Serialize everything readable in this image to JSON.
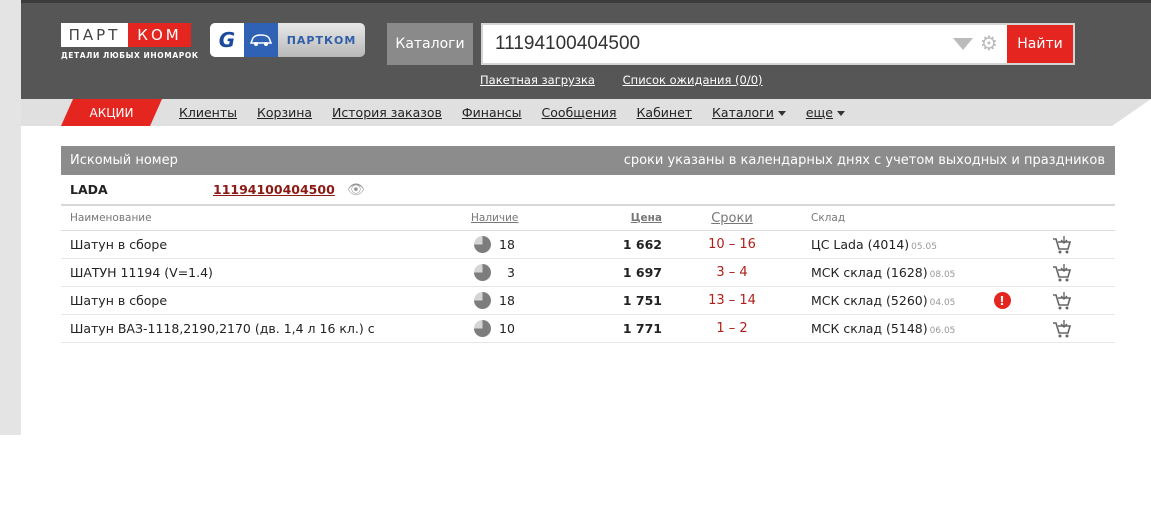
{
  "brand": {
    "logo_left": "ПАРТ",
    "logo_right": "КОМ",
    "logo_sub": "ДЕТАЛИ ЛЮБЫХ ИНОМАРОК",
    "partner_g": "G",
    "partner_label": "ПАРТКОМ"
  },
  "header": {
    "catalog_button": "Каталоги",
    "search_value": "11194100404500",
    "search_button": "Найти",
    "sublinks": [
      "Пакетная загрузка",
      "Список ожидания (0/0)"
    ]
  },
  "nav": {
    "promo": "АКЦИИ",
    "links": [
      "Клиенты",
      "Корзина",
      "История заказов",
      "Финансы",
      "Сообщения",
      "Кабинет",
      "Каталоги",
      "еще"
    ]
  },
  "results": {
    "title": "Искомый номер",
    "note": "сроки указаны в календарных днях с учетом выходных и праздников",
    "query_brand": "LADA",
    "query_number": "11194100404500",
    "columns": {
      "name": "Наименование",
      "stock": "Наличие",
      "price": "Цена",
      "term": "Сроки",
      "warehouse": "Склад"
    },
    "rows": [
      {
        "name": "Шатун в сборе",
        "stock": "18",
        "price": "1 662",
        "term": "10 – 16",
        "warehouse": "ЦС Lada (4014)",
        "date": "05.05",
        "alert": false
      },
      {
        "name": "ШАТУН 11194 (V=1.4)",
        "stock": "3",
        "price": "1 697",
        "term": "3 – 4",
        "warehouse": "МСК склад (1628)",
        "date": "08.05",
        "alert": false
      },
      {
        "name": "Шатун в сборе",
        "stock": "18",
        "price": "1 751",
        "term": "13 – 14",
        "warehouse": "МСК склад (5260)",
        "date": "04.05",
        "alert": true
      },
      {
        "name": "Шатун ВАЗ-1118,2190,2170 (дв. 1,4 л 16 кл.) с",
        "stock": "10",
        "price": "1 771",
        "term": "1 – 2",
        "warehouse": "МСК склад (5148)",
        "date": "06.05",
        "alert": false
      }
    ]
  },
  "colors": {
    "accent_red": "#e42520",
    "header_gray": "#565656",
    "term_red": "#b0201a"
  }
}
